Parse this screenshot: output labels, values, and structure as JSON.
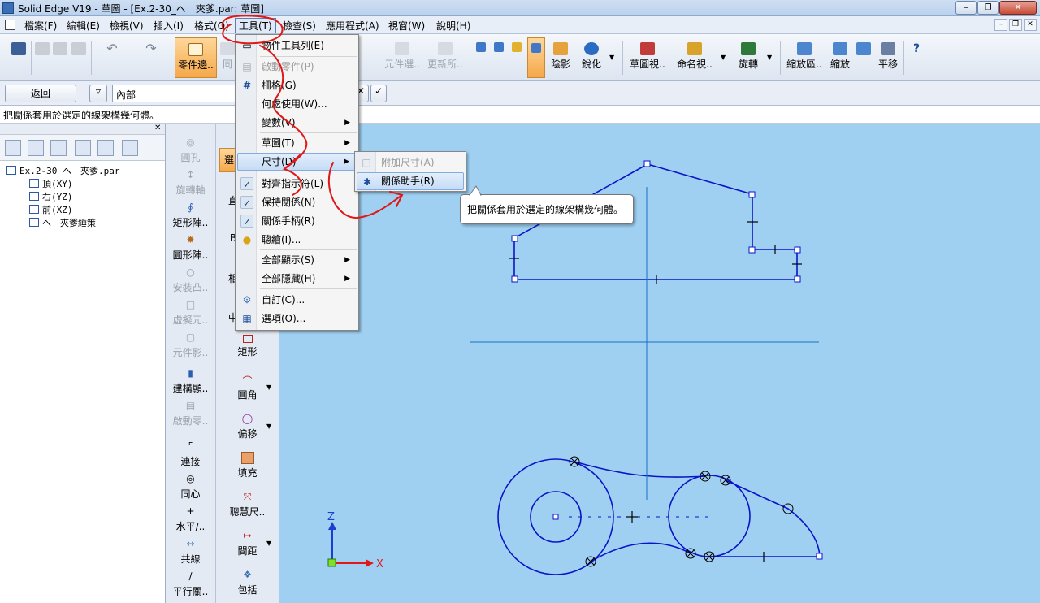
{
  "window": {
    "title": "Solid Edge V19 - 草圖 - [Ex.2-30_へ　夾爹.par: 草圖]"
  },
  "menubar": {
    "items": [
      "檔案(F)",
      "編輯(E)",
      "檢視(V)",
      "插入(I)",
      "格式(O)",
      "工具(T)",
      "檢查(S)",
      "應用程式(A)",
      "視窗(W)",
      "說明(H)"
    ],
    "open_index": 5
  },
  "toolbar": {
    "part_edge": "零件邊..",
    "same": "同",
    "component_select": "元件選..",
    "update_all": "更新所..",
    "shading": "陰影",
    "sharpen": "銳化",
    "sketch_view": "草圖視..",
    "named_view": "命名視..",
    "rotate": "旋轉",
    "zoom_area": "縮放區..",
    "zoom": "縮放",
    "pan": "平移"
  },
  "cmdbar": {
    "back_button": "返回",
    "filter_value": "內部"
  },
  "status": {
    "prompt": "把關係套用於選定的線架構幾何體。"
  },
  "tree": {
    "root": "Ex.2-30_へ　夾爹.par",
    "items": [
      "頂(XY)",
      "右(YZ)",
      "前(XZ)",
      "へ　夾爹綞策"
    ]
  },
  "ribbon1": {
    "items": [
      "圓孔",
      "旋轉軸",
      "矩形陣..",
      "圓形陣..",
      "安裝凸..",
      "虛擬元..",
      "元件影..",
      "建構顯..",
      "啟動零..",
      "連接",
      "同心",
      "水平/..",
      "共線",
      "平行關.."
    ]
  },
  "ribbon2": {
    "items": [
      "選",
      "直",
      "B",
      "相",
      "中",
      "矩形",
      "圓角",
      "偏移",
      "填充",
      "聰慧尺..",
      "間距",
      "包括"
    ]
  },
  "tools_menu": {
    "items": [
      {
        "label": "物件工具列(E)",
        "enabled": true
      },
      {
        "label": "啟動零件(P)",
        "enabled": false
      },
      {
        "label": "柵格(G)",
        "enabled": true
      },
      {
        "label": "何處使用(W)...",
        "enabled": true
      },
      {
        "label": "變數(V)",
        "enabled": true,
        "submenu": true
      },
      {
        "label": "草圖(T)",
        "enabled": true,
        "submenu": true
      },
      {
        "label": "尺寸(D)",
        "enabled": true,
        "submenu": true,
        "highlighted": true
      },
      {
        "label": "對齊指示符(L)",
        "enabled": true,
        "checked": true
      },
      {
        "label": "保持關係(N)",
        "enabled": true,
        "checked": true
      },
      {
        "label": "關係手柄(R)",
        "enabled": true,
        "checked": true
      },
      {
        "label": "聰繪(I)...",
        "enabled": true
      },
      {
        "label": "全部顯示(S)",
        "enabled": true,
        "submenu": true
      },
      {
        "label": "全部隱藏(H)",
        "enabled": true,
        "submenu": true
      },
      {
        "label": "自訂(C)...",
        "enabled": true
      },
      {
        "label": "選項(O)...",
        "enabled": true
      }
    ]
  },
  "dimension_submenu": {
    "items": [
      {
        "label": "附加尺寸(A)",
        "enabled": false
      },
      {
        "label": "關係助手(R)",
        "enabled": true,
        "highlighted": true
      }
    ]
  },
  "tooltip": {
    "text": "把關係套用於選定的線架構幾何體。"
  },
  "axes": {
    "z": "Z",
    "x": "X"
  },
  "colors": {
    "canvas": "#9fd0f2",
    "geometry": "#0a14c8",
    "annotation": "#e01818",
    "highlight": "#f5a84a"
  }
}
